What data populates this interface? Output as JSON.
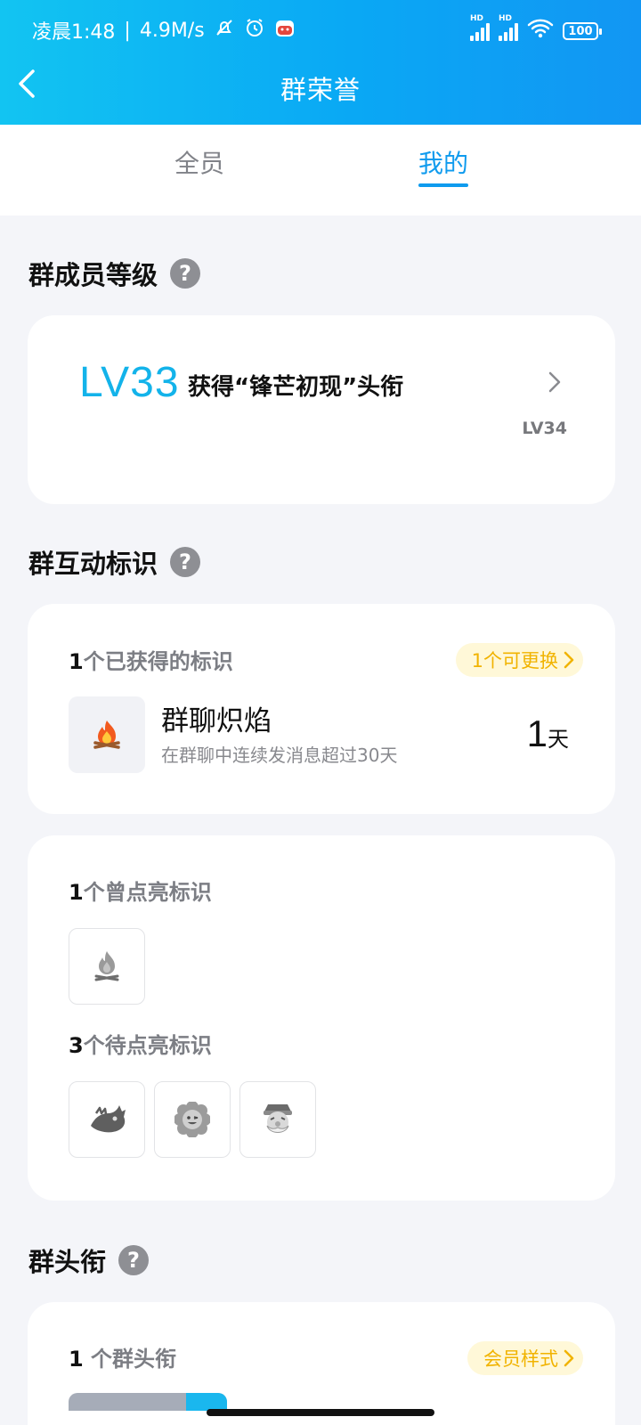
{
  "status_bar": {
    "time": "凌晨1:48",
    "separator": "|",
    "net_speed": "4.9M/s",
    "signal1_label": "HD",
    "signal2_label": "HD",
    "battery": "100"
  },
  "app_bar": {
    "title": "群荣誉"
  },
  "tabs": [
    {
      "label": "全员",
      "active": false
    },
    {
      "label": "我的",
      "active": true
    }
  ],
  "level_section": {
    "title": "群成员等级",
    "current_level": "LV33",
    "description": "获得“锋芒初现”头衔",
    "next_level": "LV34"
  },
  "interaction_section": {
    "title": "群互动标识",
    "earned": {
      "count": "1",
      "label": "个已获得的标识",
      "switch_button": "1个可更换",
      "badge": {
        "icon": "campfire",
        "name": "群聊炽焰",
        "description": "在群聊中连续发消息超过30天",
        "days": "1",
        "days_unit": "天"
      }
    },
    "lit_before": {
      "count": "1",
      "label": "个曾点亮标识",
      "icons": [
        "campfire-gray"
      ]
    },
    "pending": {
      "count": "3",
      "label": "个待点亮标识",
      "icons": [
        "dragon-gray",
        "flower-face-gray",
        "elder-face-gray"
      ]
    }
  },
  "title_section": {
    "title": "群头衔",
    "count": "1",
    "label": " 个群头衔",
    "style_button": "会员样式"
  },
  "colors": {
    "header_start": "#12c4f2",
    "header_end": "#1296f3",
    "accent": "#0f9bee",
    "level_text": "#13b3ea",
    "pill_bg": "#fff8d8",
    "pill_text": "#f1b300"
  }
}
